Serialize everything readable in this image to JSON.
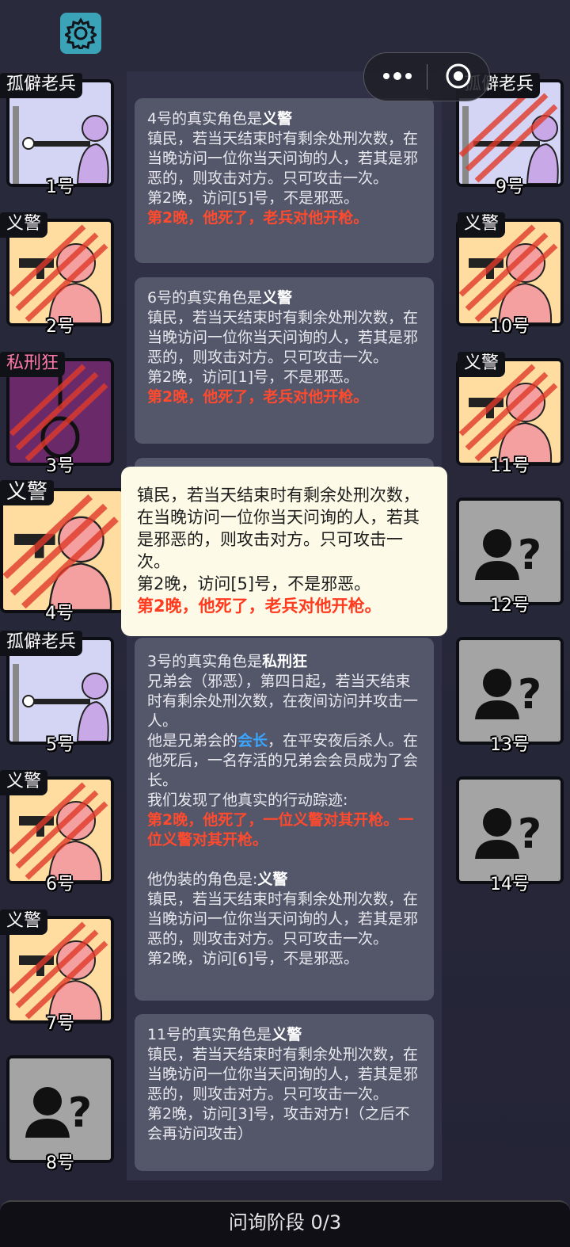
{
  "players": [
    {
      "id": "p1",
      "role": "孤僻老兵",
      "number": "1号"
    },
    {
      "id": "p2",
      "role": "义警",
      "number": "2号"
    },
    {
      "id": "p3",
      "role": "私刑狂",
      "number": "3号"
    },
    {
      "id": "p4",
      "role": "义警",
      "number": "4号"
    },
    {
      "id": "p5",
      "role": "孤僻老兵",
      "number": "5号"
    },
    {
      "id": "p6",
      "role": "义警",
      "number": "6号"
    },
    {
      "id": "p7",
      "role": "义警",
      "number": "7号"
    },
    {
      "id": "p8",
      "role": "",
      "number": "8号"
    },
    {
      "id": "p9",
      "role": "孤僻老兵",
      "number": "9号"
    },
    {
      "id": "p10",
      "role": "义警",
      "number": "10号"
    },
    {
      "id": "p11",
      "role": "义警",
      "number": "11号"
    },
    {
      "id": "p12",
      "role": "",
      "number": "12号"
    },
    {
      "id": "p13",
      "role": "",
      "number": "13号"
    },
    {
      "id": "p14",
      "role": "",
      "number": "14号"
    }
  ],
  "cards": [
    {
      "title_prefix": "4号的真实角色是",
      "title_role": "义警",
      "desc": "镇民，若当天结束时有剩余处刑次数，在当晚访问一位你当天问询的人，若其是邪恶的，则攻击对方。只可攻击一次。",
      "visit": "第2晚，访问[5]号，不是邪恶。",
      "death": "第2晚，他死了，老兵对他开枪。"
    },
    {
      "title_prefix": "6号的真实角色是",
      "title_role": "义警",
      "desc": "镇民，若当天结束时有剩余处刑次数，在当晚访问一位你当天问询的人，若其是邪恶的，则攻击对方。只可攻击一次。",
      "visit": "第2晚，访问[1]号，不是邪恶。",
      "death": "第2晚，他死了，老兵对他开枪。"
    },
    {
      "title_prefix": "3号的真实角色是",
      "title_role": "私刑狂",
      "desc": "兄弟会（邪恶），第四日起，若当天结束时有剩余处刑次数，在夜间访问并攻击一人。",
      "desc2_pre": "他是兄弟会的",
      "desc2_hl": "会长",
      "desc2_post": "，在平安夜后杀人。在他死后，一名存活的兄弟会会员成为了会长。",
      "trace": "我们发现了他真实的行动踪迹:",
      "trace_red": "第2晚，他死了，一位义警对其开枪。一位义警对其开枪。",
      "disguise_pre": "他伪装的角色是:",
      "disguise_role": "义警",
      "desc3": "镇民，若当天结束时有剩余处刑次数，在当晚访问一位你当天问询的人，若其是邪恶的，则攻击对方。只可攻击一次。",
      "visit": "第2晚，访问[6]号，不是邪恶。"
    },
    {
      "title_prefix": "11号的真实角色是",
      "title_role": "义警",
      "desc": "镇民，若当天结束时有剩余处刑次数，在当晚访问一位你当天问询的人，若其是邪恶的，则攻击对方。只可攻击一次。",
      "visit": "第2晚，访问[3]号，攻击对方!（之后不会再访问攻击）"
    }
  ],
  "popup": {
    "desc": "镇民，若当天结束时有剩余处刑次数，在当晚访问一位你当天问询的人，若其是邪恶的，则攻击对方。只可攻击一次。",
    "visit": "第2晚，访问[5]号，不是邪恶。",
    "death": "第2晚，他死了，老兵对他开枪。"
  },
  "phase": {
    "label": "问询阶段 0/3"
  },
  "colors": {
    "background": "#28283a",
    "card": "#54566a",
    "popup": "#fdfbe8",
    "death_red": "#ff4a2e",
    "leader_blue": "#3aa6ff",
    "gear": "#3aa3b8",
    "villager_bg": "#ffdca0",
    "veteran_bg": "#d4d4f4",
    "lynch_bg": "#6a2a6a",
    "unknown_bg": "#a4a4a4"
  },
  "icons": [
    "gear-icon",
    "more-dots-icon",
    "close-target-icon",
    "claw-mark-icon",
    "unknown-player-icon"
  ]
}
